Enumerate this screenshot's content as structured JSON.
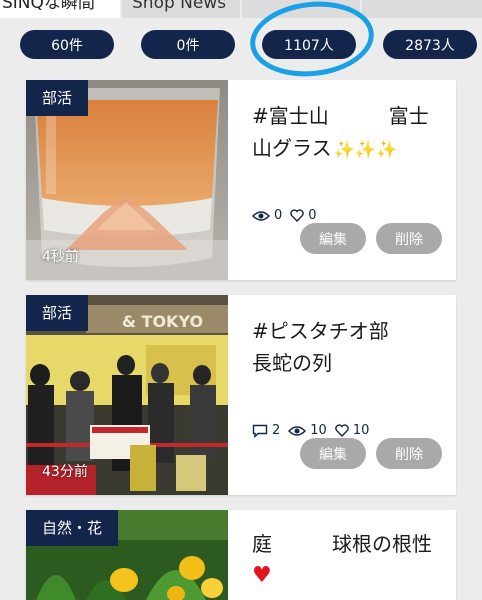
{
  "tabs": {
    "active_label": "SINQな瞬間",
    "shop_label": "Shop News"
  },
  "counters": [
    "60件",
    "0件",
    "1107人",
    "2873人"
  ],
  "posts": [
    {
      "category": "部活",
      "title_line1": "#富士山　　　富士",
      "title_line2": "山グラス",
      "sparkles": "✨✨✨",
      "time": "4秒前",
      "views": "0",
      "likes": "0",
      "edit_label": "編集",
      "delete_label": "削除"
    },
    {
      "category": "部活",
      "title_line1": "#ピスタチオ部",
      "title_line2": "長蛇の列",
      "time": "43分前",
      "comments": "2",
      "views": "10",
      "likes": "10",
      "edit_label": "編集",
      "delete_label": "削除",
      "photo_sign": "& TOKYO"
    },
    {
      "category": "自然・花",
      "title_line1": "庭　　　球根の根性",
      "heart": "♥"
    }
  ],
  "colors": {
    "navy": "#13254a",
    "annotation_blue": "#1aa0e6",
    "button_gray": "#a9a9a9",
    "heart_red": "#e0161c",
    "sparkle_gold": "#e7b53a"
  },
  "icons": [
    "eye-icon",
    "heart-outline-icon",
    "comment-icon",
    "sparkle-icon"
  ]
}
